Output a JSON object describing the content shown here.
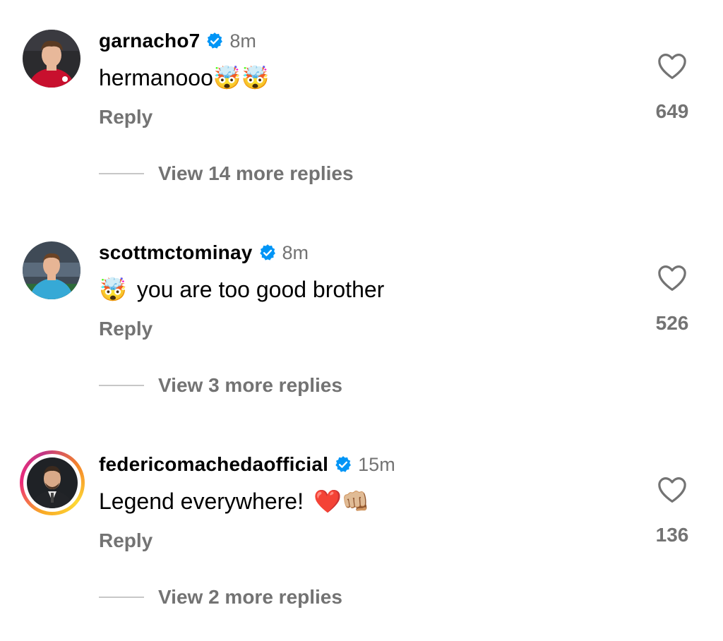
{
  "comments": [
    {
      "username": "garnacho7",
      "time": "8m",
      "text": "hermanooo",
      "emoji_before": "",
      "emoji_after": "🤯🤯",
      "reply_label": "Reply",
      "likes": "649",
      "more_replies": "View 14 more replies",
      "avatar": "red-jersey-player-avatar",
      "story_ring": false
    },
    {
      "username": "scottmctominay",
      "time": "8m",
      "text": "you are too good brother",
      "emoji_before": "🤯",
      "emoji_after": "",
      "reply_label": "Reply",
      "likes": "526",
      "more_replies": "View 3 more replies",
      "avatar": "blue-jersey-player-avatar",
      "story_ring": false
    },
    {
      "username": "federicomachedaofficial",
      "time": "15m",
      "text": "Legend everywhere!",
      "emoji_before": "",
      "emoji_after": "❤️👊🏼",
      "reply_label": "Reply",
      "likes": "136",
      "more_replies": "View 2 more replies",
      "avatar": "suited-man-avatar",
      "story_ring": true
    }
  ],
  "colors": {
    "verified": "#0095f6",
    "muted": "#737373",
    "line": "#c7c7c7"
  },
  "icons": {
    "verified": "verified-badge-icon",
    "like": "heart-outline-icon"
  }
}
